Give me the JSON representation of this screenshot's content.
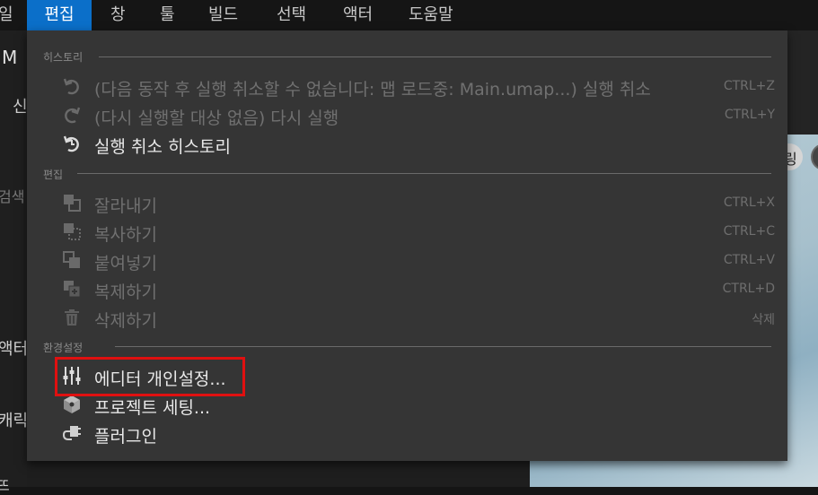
{
  "menubar": {
    "items": [
      {
        "label": "일"
      },
      {
        "label": "편집"
      },
      {
        "label": "창"
      },
      {
        "label": "툴"
      },
      {
        "label": "빌드"
      },
      {
        "label": "선택"
      },
      {
        "label": "액터"
      },
      {
        "label": "도움말"
      }
    ]
  },
  "background": {
    "tab_fragment": "M",
    "search_fragment": "검색",
    "side_label_1": "액터",
    "side_label_2": "캐릭",
    "side_label_3": "신",
    "viewport_btn": "링",
    "bottom_fragment": "뜨"
  },
  "menu": {
    "sections": {
      "history": "히스토리",
      "edit": "편집",
      "prefs": "환경설정"
    },
    "items": {
      "undo": {
        "label": "(다음 동작 후 실행 취소할 수 없습니다: 맵 로드중: Main.umap...) 실행 취소",
        "shortcut": "CTRL+Z"
      },
      "redo": {
        "label": "(다시 실행할 대상 없음) 다시 실행",
        "shortcut": "CTRL+Y"
      },
      "undo_history": {
        "label": "실행 취소 히스토리"
      },
      "cut": {
        "label": "잘라내기",
        "shortcut": "CTRL+X"
      },
      "copy": {
        "label": "복사하기",
        "shortcut": "CTRL+C"
      },
      "paste": {
        "label": "붙여넣기",
        "shortcut": "CTRL+V"
      },
      "duplicate": {
        "label": "복제하기",
        "shortcut": "CTRL+D"
      },
      "delete": {
        "label": "삭제하기",
        "shortcut": "삭제"
      },
      "editor_prefs": {
        "label": "에디터 개인설정..."
      },
      "project_settings": {
        "label": "프로젝트 세팅..."
      },
      "plugins": {
        "label": "플러그인"
      }
    }
  },
  "colors": {
    "menu_bg": "#353535",
    "active_menu": "#0b6fc9",
    "highlight": "#e01010"
  }
}
